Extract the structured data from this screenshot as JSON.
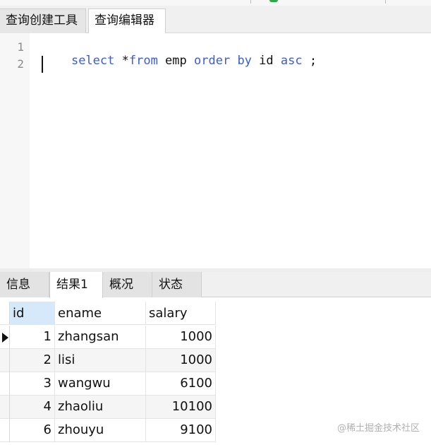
{
  "top_tabs": [
    {
      "label": "查询创建工具",
      "active": false
    },
    {
      "label": "查询编辑器",
      "active": true
    }
  ],
  "editor": {
    "line_numbers": [
      "1",
      "2"
    ],
    "tokens": [
      {
        "text": "select",
        "kind": "keyword"
      },
      {
        "text": " *",
        "kind": "plain"
      },
      {
        "text": "from",
        "kind": "keyword"
      },
      {
        "text": " emp ",
        "kind": "plain"
      },
      {
        "text": "order",
        "kind": "keyword"
      },
      {
        "text": " ",
        "kind": "plain"
      },
      {
        "text": "by",
        "kind": "keyword"
      },
      {
        "text": " id ",
        "kind": "plain"
      },
      {
        "text": "asc",
        "kind": "keyword"
      },
      {
        "text": " ;",
        "kind": "plain"
      }
    ]
  },
  "result_tabs": [
    {
      "label": "信息",
      "active": false
    },
    {
      "label": "结果1",
      "active": true
    },
    {
      "label": "概况",
      "active": false
    },
    {
      "label": "状态",
      "active": false
    }
  ],
  "grid": {
    "columns": [
      "id",
      "ename",
      "salary"
    ],
    "rows": [
      {
        "id": "1",
        "ename": "zhangsan",
        "salary": "1000",
        "current": true
      },
      {
        "id": "2",
        "ename": "lisi",
        "salary": "1000",
        "current": false
      },
      {
        "id": "3",
        "ename": "wangwu",
        "salary": "6100",
        "current": false
      },
      {
        "id": "4",
        "ename": "zhaoliu",
        "salary": "10100",
        "current": false
      },
      {
        "id": "6",
        "ename": "zhouyu",
        "salary": "9100",
        "current": false
      }
    ]
  },
  "watermark": "@稀土掘金技术社区",
  "colors": {
    "keyword": "#3b5bdb",
    "header_selected": "#d6e9fa"
  }
}
